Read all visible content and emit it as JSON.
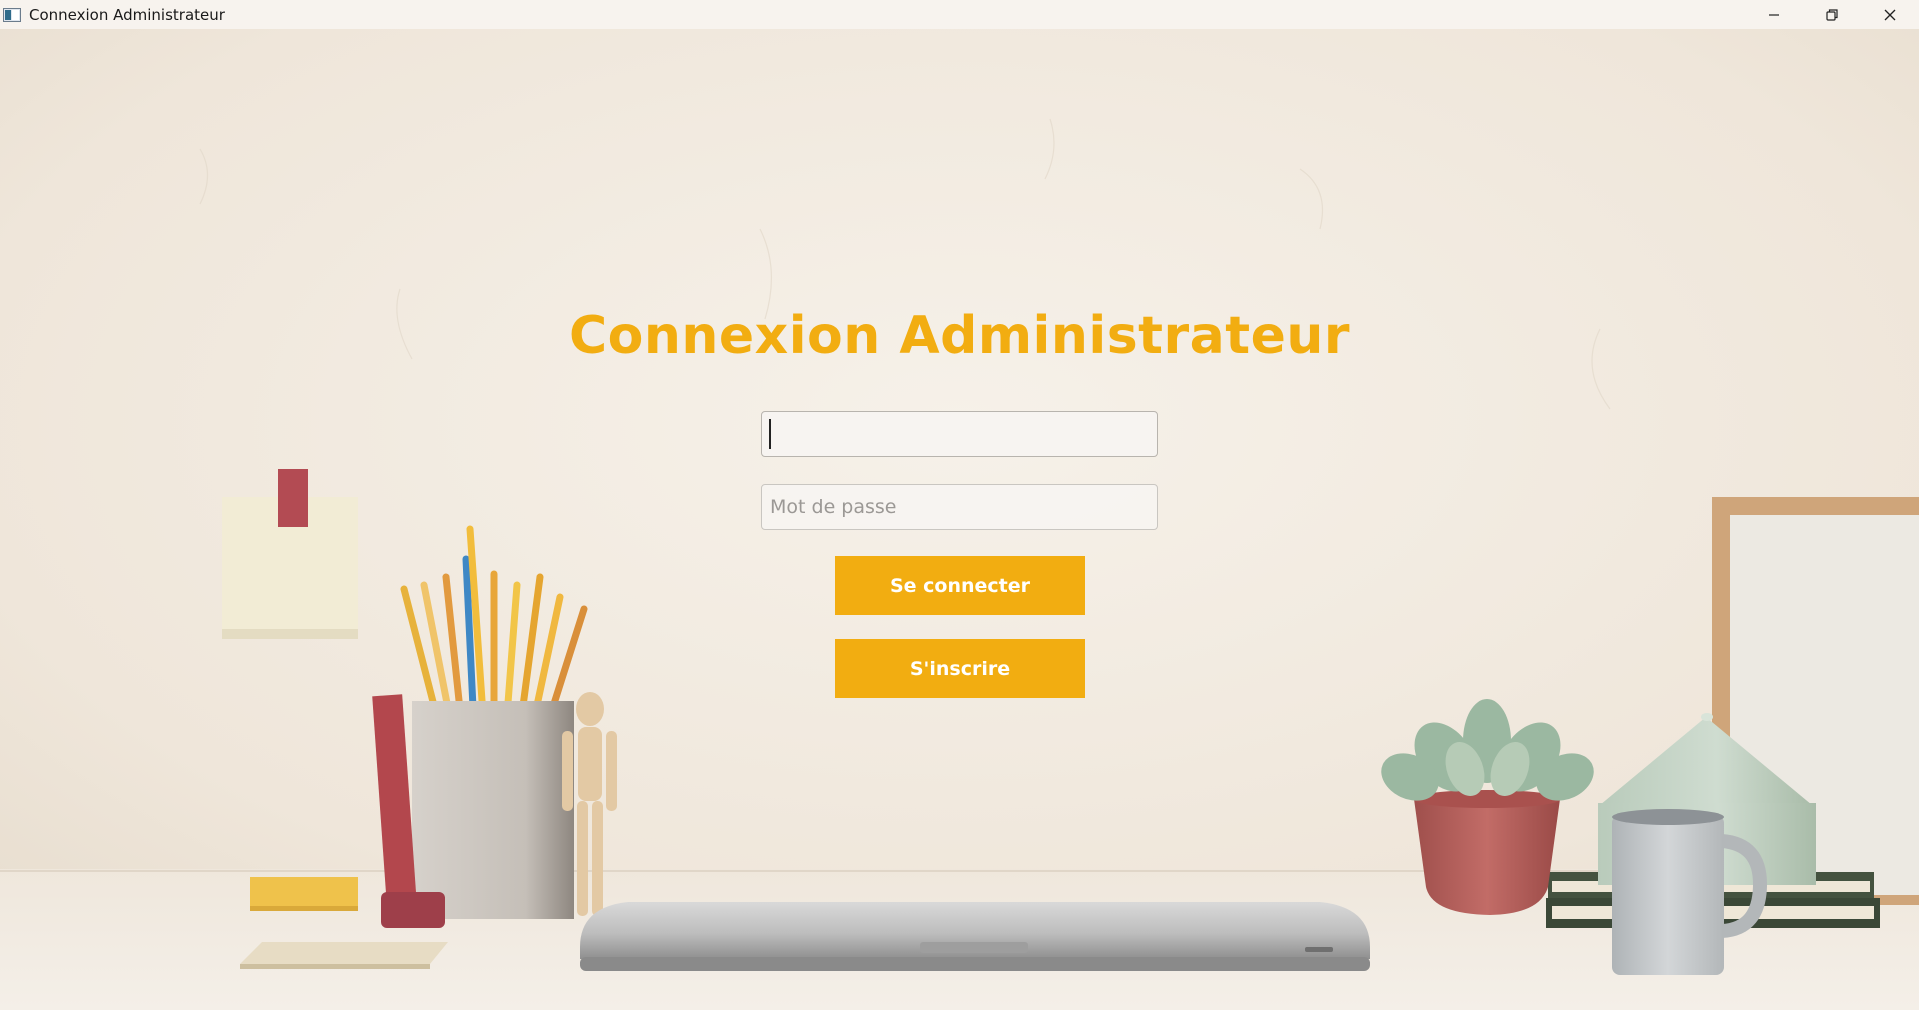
{
  "window": {
    "title": "Connexion Administrateur",
    "controls": {
      "minimize": "minimize-icon",
      "restore": "restore-icon",
      "close": "close-icon"
    }
  },
  "login": {
    "heading": "Connexion Administrateur",
    "username": {
      "value": "",
      "placeholder": ""
    },
    "password": {
      "value": "",
      "placeholder": "Mot de passe"
    },
    "login_button": "Se connecter",
    "signup_button": "S'inscrire"
  },
  "colors": {
    "accent": "#f2ad11",
    "background": "#f3ece2",
    "button_text": "#ffffff"
  }
}
